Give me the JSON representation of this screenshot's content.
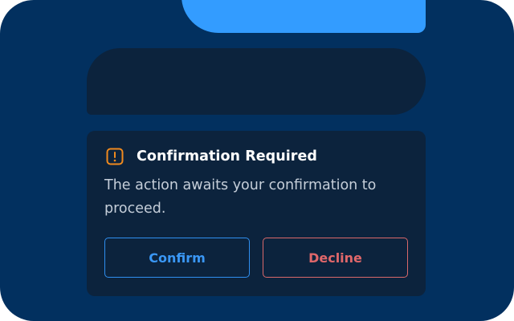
{
  "dialog": {
    "title": "Confirmation Required",
    "message": "The action awaits your confirmation to proceed.",
    "icon": "warning-icon",
    "confirm_label": "Confirm",
    "decline_label": "Decline"
  },
  "colors": {
    "background": "#02305f",
    "top_bar": "#339cff",
    "panel": "#0c233d",
    "warning": "#f08a1e",
    "confirm": "#3a97f5",
    "decline": "#e0676a"
  }
}
